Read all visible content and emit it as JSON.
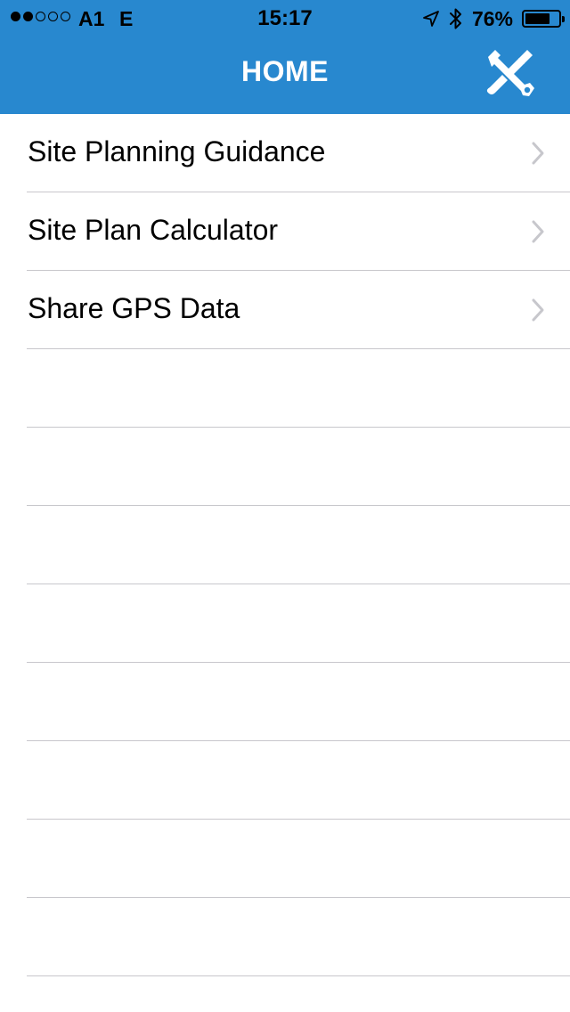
{
  "status_bar": {
    "signal_filled": 2,
    "signal_total": 5,
    "carrier": "A1",
    "network": "E",
    "time": "15:17",
    "battery_text": "76%",
    "battery_level": 0.76,
    "icons": [
      "location-arrow-icon",
      "bluetooth-icon",
      "battery-icon"
    ]
  },
  "nav": {
    "title": "HOME",
    "settings_icon": "tools-icon"
  },
  "menu": {
    "items": [
      {
        "label": "Site Planning Guidance",
        "icon": "chevron-right-icon"
      },
      {
        "label": "Site Plan Calculator",
        "icon": "chevron-right-icon"
      },
      {
        "label": "Share GPS Data",
        "icon": "chevron-right-icon"
      }
    ],
    "empty_rows": 8
  },
  "colors": {
    "header_bg": "#2888cf",
    "separator": "#c8c7cc",
    "chevron": "#c7c7cc"
  }
}
